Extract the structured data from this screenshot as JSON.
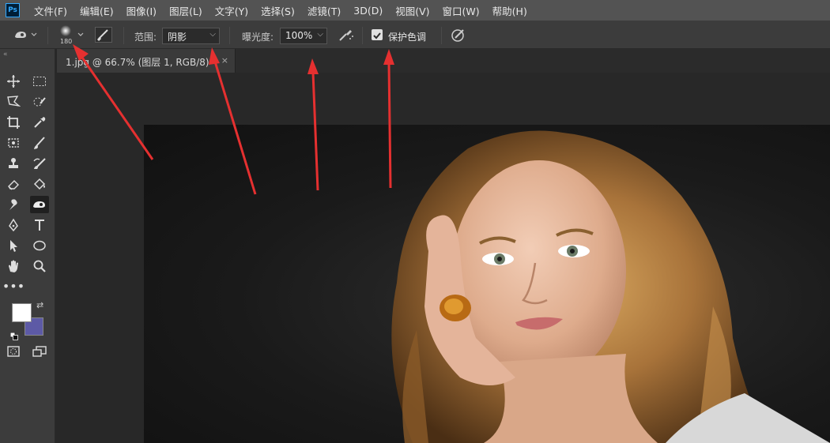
{
  "app": {
    "logo": "Ps"
  },
  "menu": [
    "文件(F)",
    "编辑(E)",
    "图像(I)",
    "图层(L)",
    "文字(Y)",
    "选择(S)",
    "滤镜(T)",
    "3D(D)",
    "视图(V)",
    "窗口(W)",
    "帮助(H)"
  ],
  "options": {
    "brush_size": "180",
    "range_label": "范围:",
    "range_value": "阴影",
    "exposure_label": "曝光度:",
    "exposure_value": "100%",
    "protect_tones_label": "保护色调",
    "protect_tones_checked": true
  },
  "document": {
    "tab_title": "1.jpg @ 66.7% (图层 1, RGB/8)",
    "close_glyph": "×"
  },
  "colors": {
    "foreground": "#ffffff",
    "background": "#5d5aa6",
    "annotation_arrow": "#e53030"
  }
}
